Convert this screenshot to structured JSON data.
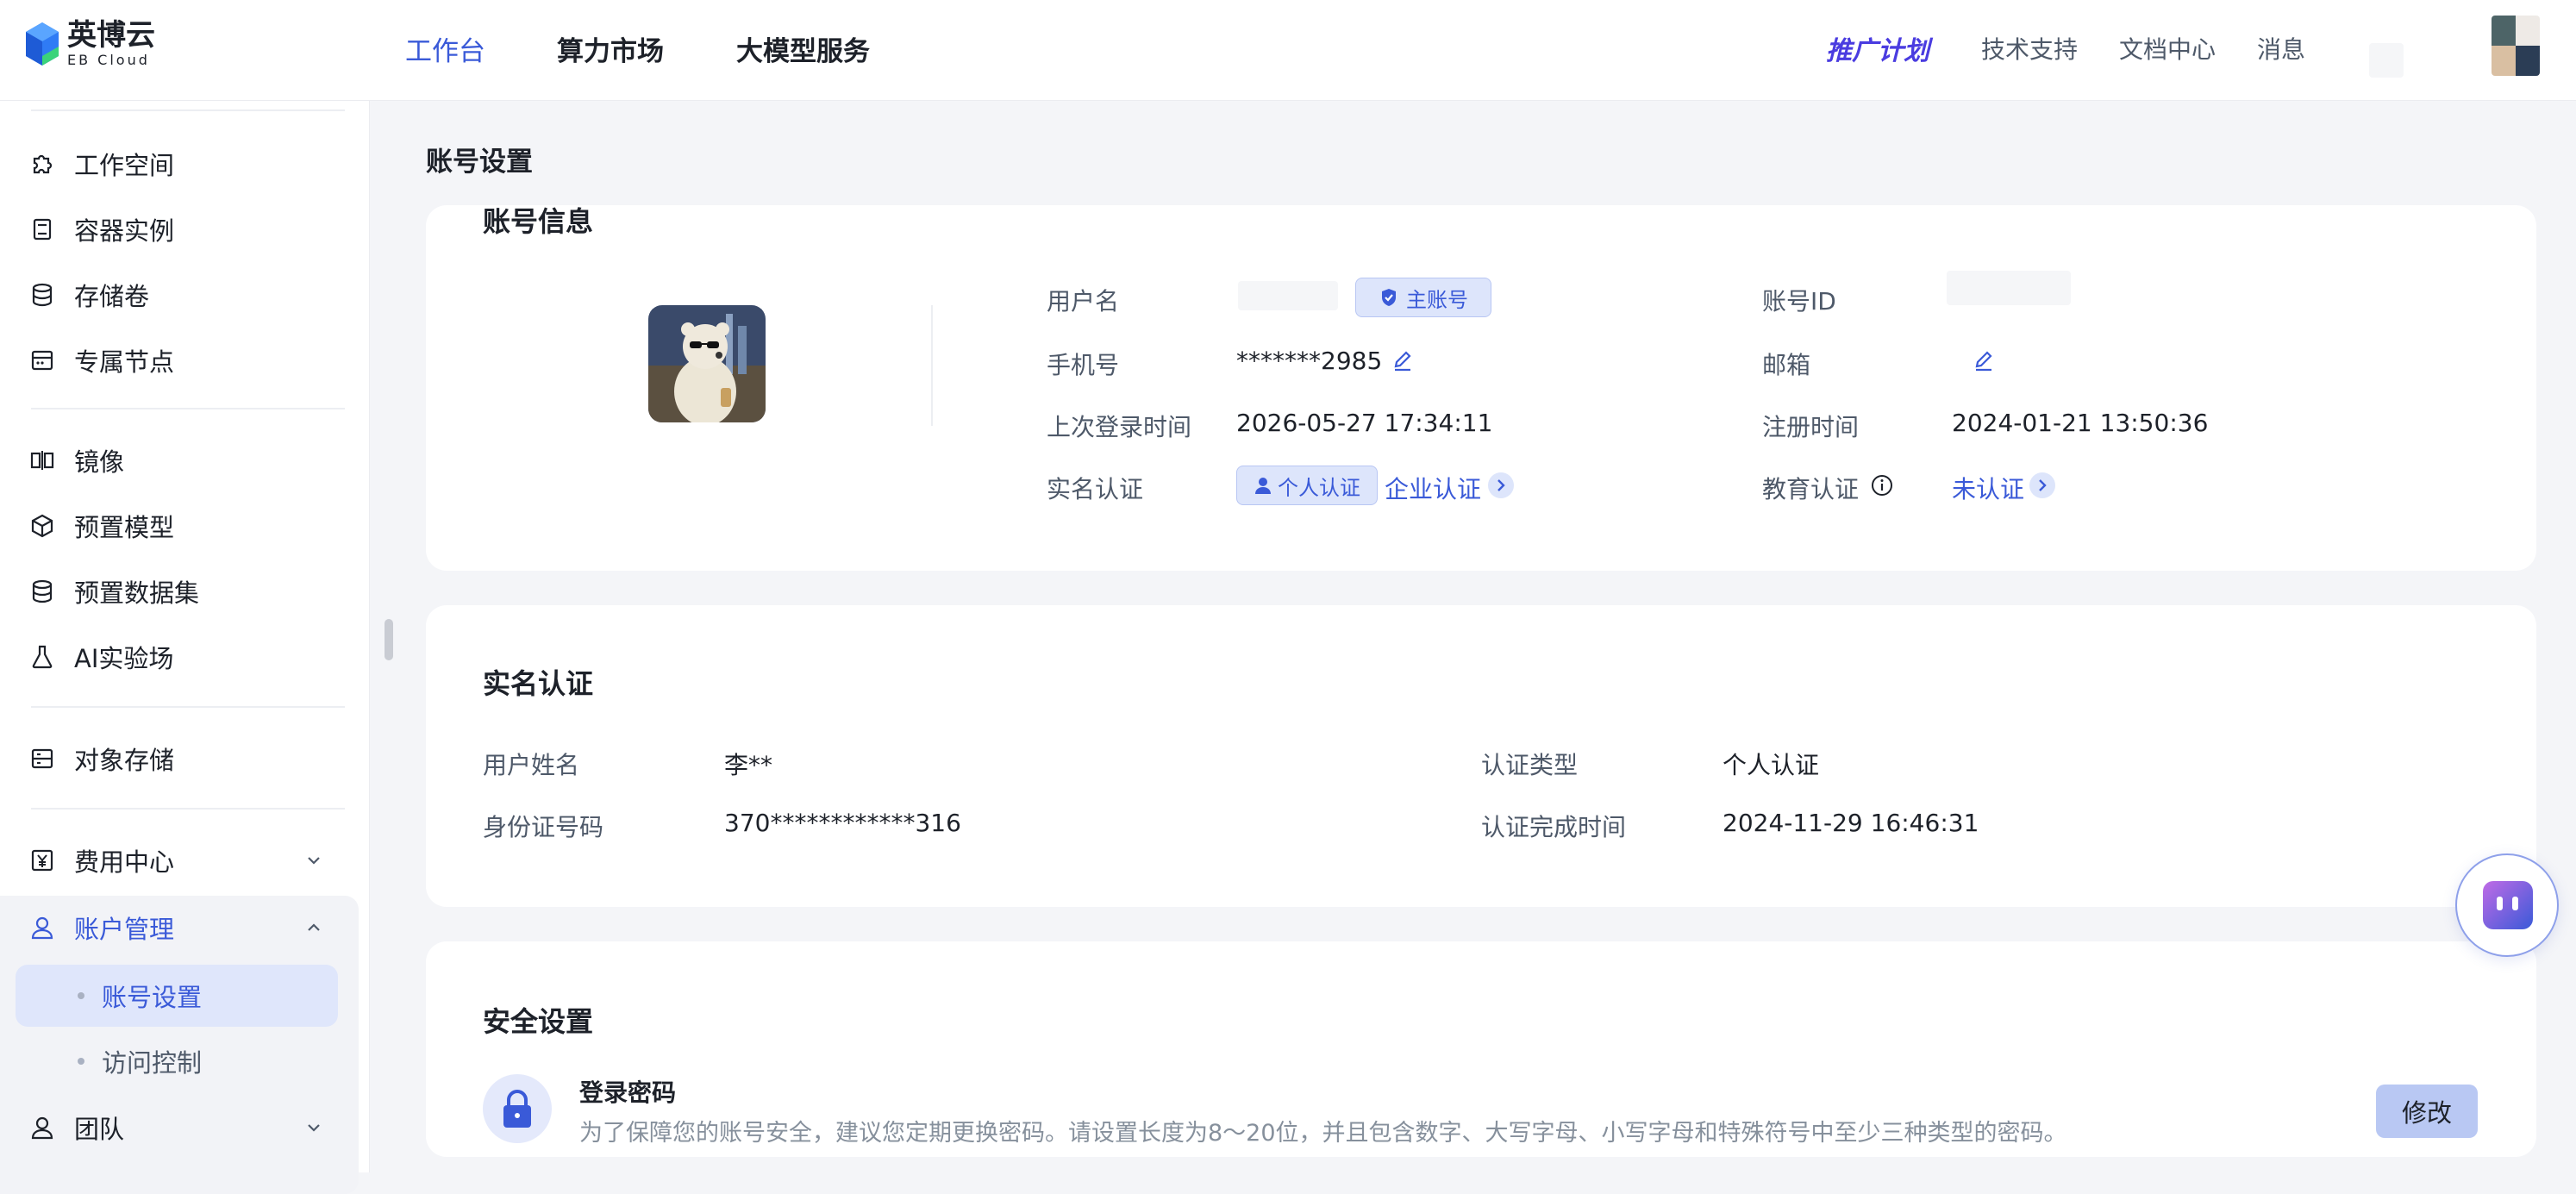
{
  "brand": {
    "name_cn": "英博云",
    "name_en": "EB Cloud"
  },
  "topnav": {
    "items": [
      {
        "label": "工作台",
        "active": true
      },
      {
        "label": "算力市场",
        "active": false
      },
      {
        "label": "大模型服务",
        "active": false
      }
    ],
    "promo": "推广计划",
    "links": [
      "技术支持",
      "文档中心",
      "消息"
    ]
  },
  "sidebar": {
    "items": [
      {
        "label": "工作空间",
        "icon": "puzzle-icon"
      },
      {
        "label": "容器实例",
        "icon": "container-icon"
      },
      {
        "label": "存储卷",
        "icon": "database-icon"
      },
      {
        "label": "专属节点",
        "icon": "node-icon"
      },
      {
        "label": "镜像",
        "icon": "mirror-icon"
      },
      {
        "label": "预置模型",
        "icon": "cube-icon"
      },
      {
        "label": "预置数据集",
        "icon": "dataset-icon"
      },
      {
        "label": "AI实验场",
        "icon": "flask-icon"
      },
      {
        "label": "对象存储",
        "icon": "storage-icon"
      },
      {
        "label": "费用中心",
        "icon": "yen-icon"
      },
      {
        "label": "账户管理",
        "icon": "user-icon"
      },
      {
        "label": "团队",
        "icon": "team-icon"
      }
    ],
    "account_sub": [
      {
        "label": "账号设置",
        "active": true
      },
      {
        "label": "访问控制",
        "active": false
      }
    ]
  },
  "page": {
    "title": "账号设置"
  },
  "account_info": {
    "title": "账号信息",
    "username_label": "用户名",
    "main_account_tag": "主账号",
    "account_id_label": "账号ID",
    "phone_label": "手机号",
    "phone_value": "*******2985",
    "email_label": "邮箱",
    "last_login_label": "上次登录时间",
    "last_login_value": "2026-05-27 17:34:11",
    "register_label": "注册时间",
    "register_value": "2024-01-21 13:50:36",
    "realname_label": "实名认证",
    "personal_tag": "个人认证",
    "enterprise_link": "企业认证",
    "edu_label": "教育认证",
    "edu_value": "未认证"
  },
  "realname": {
    "title": "实名认证",
    "name_label": "用户姓名",
    "name_value": "李**",
    "type_label": "认证类型",
    "type_value": "个人认证",
    "id_label": "身份证号码",
    "id_value": "370************316",
    "time_label": "认证完成时间",
    "time_value": "2024-11-29 16:46:31"
  },
  "security": {
    "title": "安全设置",
    "pwd_title": "登录密码",
    "pwd_desc": "为了保障您的账号安全，建议您定期更换密码。请设置长度为8～20位，并且包含数字、大写字母、小写字母和特殊符号中至少三种类型的密码。",
    "modify_button": "修改"
  },
  "colors": {
    "accent": "#3a5ad8",
    "tag_bg": "#dde5fb",
    "page_bg": "#f4f5f8"
  }
}
